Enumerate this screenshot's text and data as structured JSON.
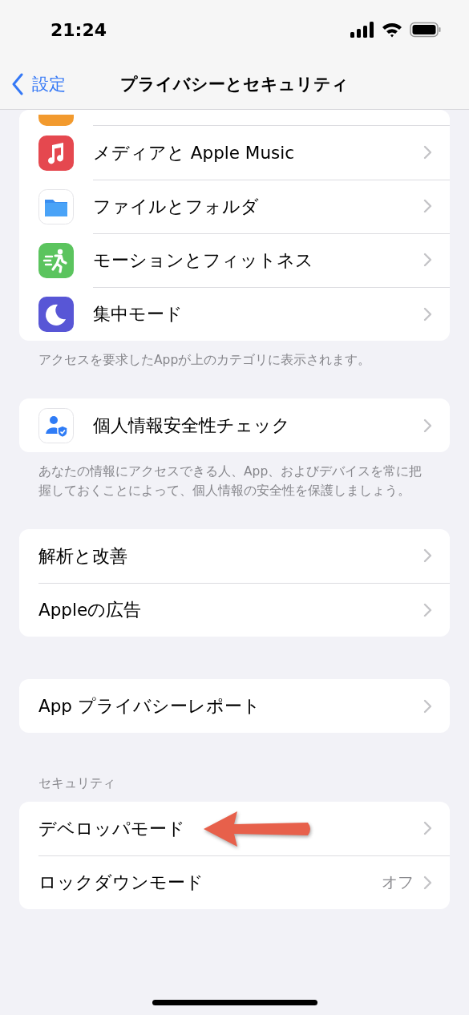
{
  "status_bar": {
    "time": "21:24"
  },
  "nav": {
    "back": "設定",
    "title": "プライバシーとセキュリティ"
  },
  "groups": [
    {
      "rows": [
        {
          "kind": "clipped"
        },
        {
          "kind": "app",
          "label": "メディアと Apple Music"
        },
        {
          "kind": "app",
          "label": "ファイルとフォルダ"
        },
        {
          "kind": "app",
          "label": "モーションとフィットネス"
        },
        {
          "kind": "app",
          "label": "集中モード"
        }
      ],
      "footer": "アクセスを要求したAppが上のカテゴリに表示されます。"
    },
    {
      "rows": [
        {
          "kind": "app",
          "label": "個人情報安全性チェック"
        }
      ],
      "footer": "あなたの情報にアクセスできる人、App、およびデバイスを常に把握しておくことによって、個人情報の安全性を保護しましょう。"
    },
    {
      "rows": [
        {
          "kind": "plain",
          "label": "解析と改善"
        },
        {
          "kind": "plain",
          "label": "Appleの広告"
        }
      ]
    },
    {
      "rows": [
        {
          "kind": "plain",
          "label": "App プライバシーレポート"
        }
      ]
    },
    {
      "header": "セキュリティ",
      "rows": [
        {
          "kind": "plain",
          "label": "デベロッパモード",
          "pointed": true
        },
        {
          "kind": "plain",
          "label": "ロックダウンモード",
          "value": "オフ"
        }
      ]
    }
  ]
}
